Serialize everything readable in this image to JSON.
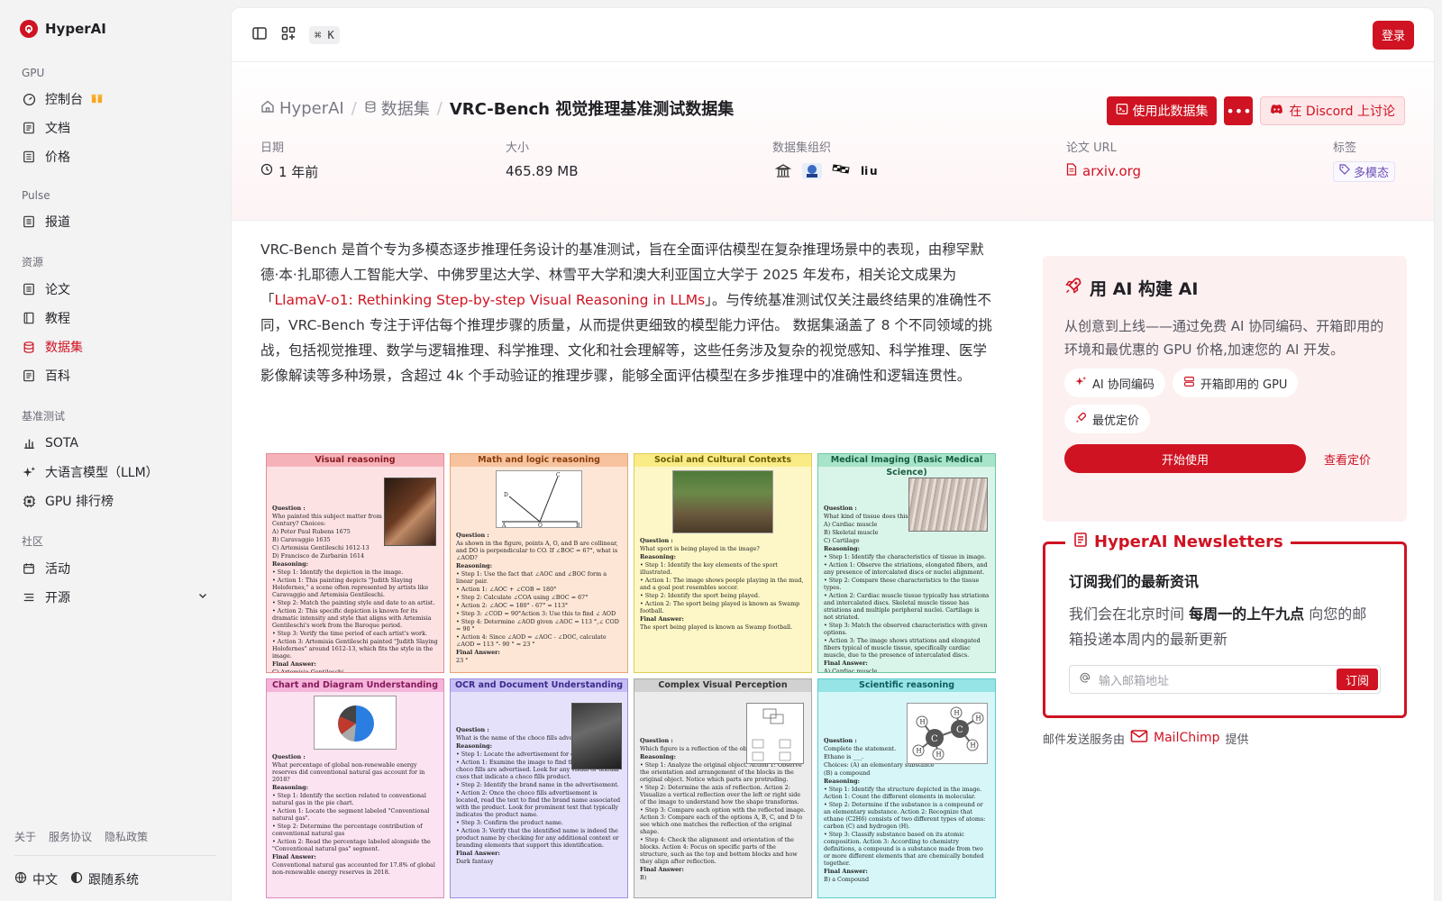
{
  "brand": {
    "name": "HyperAI"
  },
  "sidebar": {
    "sections": [
      {
        "title": "GPU",
        "items": [
          {
            "label": "控制台",
            "icon": "gauge-icon"
          },
          {
            "label": "文档",
            "icon": "doc-icon"
          },
          {
            "label": "价格",
            "icon": "price-icon"
          }
        ]
      },
      {
        "title": "Pulse",
        "items": [
          {
            "label": "报道",
            "icon": "news-icon"
          }
        ]
      },
      {
        "title": "资源",
        "items": [
          {
            "label": "论文",
            "icon": "paper-icon"
          },
          {
            "label": "教程",
            "icon": "book-icon"
          },
          {
            "label": "数据集",
            "icon": "database-icon",
            "active": true
          },
          {
            "label": "百科",
            "icon": "wiki-icon"
          }
        ]
      },
      {
        "title": "基准测试",
        "items": [
          {
            "label": "SOTA",
            "icon": "bar-chart-icon"
          },
          {
            "label": "大语言模型（LLM）",
            "icon": "sparkle-icon"
          },
          {
            "label": "GPU 排行榜",
            "icon": "chip-icon"
          }
        ]
      },
      {
        "title": "社区",
        "items": [
          {
            "label": "活动",
            "icon": "calendar-icon"
          },
          {
            "label": "开源",
            "icon": "list-icon"
          }
        ]
      }
    ],
    "footer_links": [
      "关于",
      "服务协议",
      "隐私政策"
    ],
    "language": "中文",
    "theme": "跟随系统"
  },
  "topbar": {
    "shortcut": "⌘ K",
    "login": "登录"
  },
  "breadcrumb": {
    "home": "HyperAI",
    "section": "数据集",
    "current": "VRC-Bench 视觉推理基准测试数据集"
  },
  "actions": {
    "use_dataset": "使用此数据集",
    "more": "•••",
    "discord": "在 Discord 上讨论"
  },
  "meta": {
    "date_label": "日期",
    "date_value": "1 年前",
    "size_label": "大小",
    "size_value": "465.89 MB",
    "org_label": "数据集组织",
    "paper_label": "论文 URL",
    "paper_value": "arxiv.org",
    "tag_label": "标签",
    "tag_value": "多模态"
  },
  "description": {
    "part1": "VRC-Bench 是首个专为多模态逐步推理任务设计的基准测试，旨在全面评估模型在复杂推理场景中的表现，由穆罕默德·本·扎耶德人工智能大学、中佛罗里达大学、林雪平大学和澳大利亚国立大学于 2025 年发布，相关论文成果为「",
    "paper_title": "LlamaV-o1: Rethinking Step-by-step Visual Reasoning in LLMs",
    "part2": "」。与传统基准测试仅关注最终结果的准确性不同，VRC-Bench 专注于评估每个推理步骤的质量，从而提供更细致的模型能力评估。 数据集涵盖了 8 个不同领域的挑战，包括视觉推理、数学与逻辑推理、科学推理、文化和社会理解等，这些任务涉及复杂的视觉感知、科学推理、医学影像解读等多种场景，含超过 4k 个手动验证的推理步骤，能够全面评估模型在多步推理中的准确性和逻辑连贯性。"
  },
  "figure": {
    "cells": [
      {
        "title": "Visual reasoning",
        "lines": [
          "Question :",
          "Who painted this subject matter from 16th-17th Century? Choices:",
          "A) Peter Paul Rubens 1675",
          "B) Caravaggio 1635",
          "C) Artemisia Gentileschi 1612-13",
          "D) Francisco de Zurbarán 1614",
          "Reasoning:",
          "• Step 1: Identify the depiction in the image.",
          "• Action 1: This painting depicts \"Judith Slaying Holofernes,\" a scene often represented by artists like Caravaggio and Artemisia Gentileschi.",
          "• Step 2: Match the painting style and date to an artist.",
          "• Action 2: This specific depiction is known for its dramatic intensity and style that aligns with Artemisia Gentileschi's work from the Baroque period.",
          "• Step 3: Verify the time period of each artist's work.",
          "• Action 3: Artemisia Gentileschi painted \"Judith Slaying Holofernes\" around 1612-13, which fits the style in the image.",
          "Final Answer:",
          "C) Artemisia Gentileschi"
        ]
      },
      {
        "title": "Math and logic reasoning",
        "lines": [
          "Question :",
          "As shown in the figure, points A, O, and B are collinear, and DO is perpendicular to CO. If ∠BOC = 67°, what is ∠AOD?",
          "Reasoning:",
          "• Step 1: Use the fact that ∠AOC and ∠BOC form a linear pair.",
          "• Action 1: ∠AOC + ∠COB = 180°",
          "• Step 2: Calculate ∠COA using ∠BOC = 67°",
          "• Action 2: ∠AOC = 180° - 67° = 113°",
          "• Step 3: ∠COD = 90°Action 3: Use this to find ∠ AOD",
          "• Step 4: Determine ∠AOD given ∠AOC = 113 °,∠ COD = 90 °",
          "• Action 4: Since ∠AOD = ∠AOC - ∠DOC, calculate ∠AOD = 113 °- 90 ° = 23 °",
          "Final Answer:",
          "23 °"
        ]
      },
      {
        "title": "Social and Cultural Contexts",
        "lines": [
          "Question :",
          "What sport is being played in the image?",
          "Reasoning:",
          "• Step 1: Identify the key elements of the sport illustrated.",
          "• Action 1: The image shows people playing in the mud, and a goal post resembles soccer.",
          "• Step 2: Identify the sport being played.",
          "• Action 2: The sport being played is known as Swamp football.",
          "Final Answer:",
          "The sport being played is known as Swamp football."
        ]
      },
      {
        "title": "Medical Imaging (Basic Medical Science)",
        "lines": [
          "Question :",
          "What kind of tissue does this image depict? Choices:",
          "A) Cardiac muscle",
          "B) Skeletal muscle",
          "C) Cartilage",
          "Reasoning:",
          "• Step 1: Identify the characteristics of tissue in image.",
          "• Action 1: Observe the striations, elongated fibers, and any presence of intercalated discs or nuclei alignment.",
          "• Step 2: Compare these characteristics to the tissue types.",
          "• Action 2: Cardiac muscle tissue typically has striations and intercalated discs. Skeletal muscle tissue has striations and multiple peripheral nuclei. Cartilage is not striated.",
          "• Step 3: Match the observed characteristics with given options.",
          "• Action 3: The image shows striations and elongated fibers typical of muscle tissue, specifically cardiac muscle, due to the presence of intercalated discs.",
          "Final Answer:",
          "A) Cardiac muscle"
        ]
      },
      {
        "title": "Chart and Diagram Understanding",
        "lines": [
          "Question :",
          "What percentage of global non-renewable energy reserves did conventional natural gas account for in 2018?",
          "Reasoning:",
          "• Step 1: Identify the section related to conventional natural gas in the pie chart.",
          "• Action 1: Locate the segment labeled \"Conventional natural gas\".",
          "• Step 2: Determine the percentage contribution of conventional natural gas",
          "• Action 2: Read the percentage labeled alongside the \"Conventional natural gas\" segment.",
          "Final Answer:",
          "Conventional natural gas accounted for 17.8% of global non-renewable energy reserves in 2018."
        ]
      },
      {
        "title": "OCR and Document Understanding",
        "lines": [
          "Question :",
          "What is the name of the choco fills advertised?",
          "Reasoning:",
          "• Step 1: Locate the advertisement for choco fills.",
          "• Action 1: Examine the image to find the section where choco fills are advertised. Look for any visual or textual cues that indicate a choco fills product.",
          "• Step 2: Identify the brand name in the advertisement.",
          "• Action 2: Once the choco fills advertisement is located, read the text to find the brand name associated with the product. Look for prominent text that typically indicates the product name.",
          "• Step 3: Confirm the product name.",
          "• Action 3: Verify that the identified name is indeed the product name by checking for any additional context or branding elements that support this identification.",
          "Final Answer:",
          "Dark fantasy"
        ]
      },
      {
        "title": "Complex Visual Perception",
        "lines": [
          "Question :",
          "Which figure is a reflection of the object?",
          "Reasoning:",
          "• Step 1: Analyze the original object. Action 1: Observe the orientation and arrangement of the blocks in the original object. Notice which parts are protruding.",
          "• Step 2: Determine the axis of reflection. Action 2: Visualize a vertical reflection over the left or right side of the image to understand how the shape transforms.",
          "• Step 3: Compare each option with the reflected image. Action 3: Compare each of the options A, B, C, and D to see which one matches the reflection of the original shape.",
          "• Step 4: Check the alignment and orientation of the blocks. Action 4: Focus on specific parts of the structure, such as the top and bottom blocks and how they align after reflection.",
          "Final Answer:",
          "B)"
        ]
      },
      {
        "title": "Scientific reasoning",
        "lines": [
          "Question :",
          "Complete the statement.",
          "Ethane is ___.",
          "Choices: (A) an elementary substance",
          "(B) a compound",
          "Reasoning:",
          "• Step 1: Identify the structure depicted in the image. Action 1: Count the different elements in molecular.",
          "• Step 2: Determine if the substance is a compound or an elementary substance. Action 2: Recognize that ethane (C2H6) consists of two different types of atoms: carbon (C) and hydrogen (H).",
          "• Step 3: Classify substance based on its atomic composition. Action 3: According to chemistry definitions, a compound is a substance made from two or more different elements that are chemically bonded together.",
          "Final Answer:",
          "B) a Compound"
        ]
      }
    ]
  },
  "promo": {
    "title": "用 AI 构建 AI",
    "subtitle": "从创意到上线——通过免费 AI 协同编码、开箱即用的环境和最优惠的 GPU 价格,加速您的 AI 开发。",
    "chips": [
      "AI 协同编码",
      "开箱即用的 GPU",
      "最优定价"
    ],
    "start": "开始使用",
    "pricing": "查看定价"
  },
  "newsletter": {
    "legend": "HyperAI Newsletters",
    "heading": "订阅我们的最新资讯",
    "body_pre": "我们会在北京时间 ",
    "body_bold": "每周一的上午九点",
    "body_post": " 向您的邮箱投递本周内的最新更新",
    "placeholder": "输入邮箱地址",
    "subscribe": "订阅",
    "provider_pre": "邮件发送服务由",
    "provider": "MailChimp",
    "provider_post": "提供"
  },
  "colors": {
    "accent": "#cf1322",
    "tag": "#6b4fb3"
  }
}
